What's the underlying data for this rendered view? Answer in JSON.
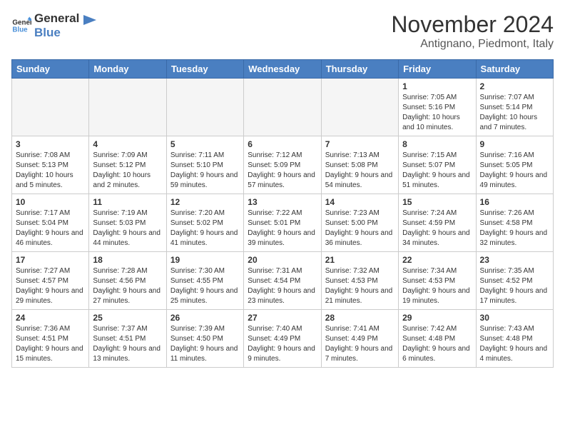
{
  "header": {
    "logo_line1": "General",
    "logo_line2": "Blue",
    "title": "November 2024",
    "subtitle": "Antignano, Piedmont, Italy"
  },
  "weekdays": [
    "Sunday",
    "Monday",
    "Tuesday",
    "Wednesday",
    "Thursday",
    "Friday",
    "Saturday"
  ],
  "weeks": [
    [
      {
        "day": "",
        "info": ""
      },
      {
        "day": "",
        "info": ""
      },
      {
        "day": "",
        "info": ""
      },
      {
        "day": "",
        "info": ""
      },
      {
        "day": "",
        "info": ""
      },
      {
        "day": "1",
        "info": "Sunrise: 7:05 AM\nSunset: 5:16 PM\nDaylight: 10 hours and 10 minutes."
      },
      {
        "day": "2",
        "info": "Sunrise: 7:07 AM\nSunset: 5:14 PM\nDaylight: 10 hours and 7 minutes."
      }
    ],
    [
      {
        "day": "3",
        "info": "Sunrise: 7:08 AM\nSunset: 5:13 PM\nDaylight: 10 hours and 5 minutes."
      },
      {
        "day": "4",
        "info": "Sunrise: 7:09 AM\nSunset: 5:12 PM\nDaylight: 10 hours and 2 minutes."
      },
      {
        "day": "5",
        "info": "Sunrise: 7:11 AM\nSunset: 5:10 PM\nDaylight: 9 hours and 59 minutes."
      },
      {
        "day": "6",
        "info": "Sunrise: 7:12 AM\nSunset: 5:09 PM\nDaylight: 9 hours and 57 minutes."
      },
      {
        "day": "7",
        "info": "Sunrise: 7:13 AM\nSunset: 5:08 PM\nDaylight: 9 hours and 54 minutes."
      },
      {
        "day": "8",
        "info": "Sunrise: 7:15 AM\nSunset: 5:07 PM\nDaylight: 9 hours and 51 minutes."
      },
      {
        "day": "9",
        "info": "Sunrise: 7:16 AM\nSunset: 5:05 PM\nDaylight: 9 hours and 49 minutes."
      }
    ],
    [
      {
        "day": "10",
        "info": "Sunrise: 7:17 AM\nSunset: 5:04 PM\nDaylight: 9 hours and 46 minutes."
      },
      {
        "day": "11",
        "info": "Sunrise: 7:19 AM\nSunset: 5:03 PM\nDaylight: 9 hours and 44 minutes."
      },
      {
        "day": "12",
        "info": "Sunrise: 7:20 AM\nSunset: 5:02 PM\nDaylight: 9 hours and 41 minutes."
      },
      {
        "day": "13",
        "info": "Sunrise: 7:22 AM\nSunset: 5:01 PM\nDaylight: 9 hours and 39 minutes."
      },
      {
        "day": "14",
        "info": "Sunrise: 7:23 AM\nSunset: 5:00 PM\nDaylight: 9 hours and 36 minutes."
      },
      {
        "day": "15",
        "info": "Sunrise: 7:24 AM\nSunset: 4:59 PM\nDaylight: 9 hours and 34 minutes."
      },
      {
        "day": "16",
        "info": "Sunrise: 7:26 AM\nSunset: 4:58 PM\nDaylight: 9 hours and 32 minutes."
      }
    ],
    [
      {
        "day": "17",
        "info": "Sunrise: 7:27 AM\nSunset: 4:57 PM\nDaylight: 9 hours and 29 minutes."
      },
      {
        "day": "18",
        "info": "Sunrise: 7:28 AM\nSunset: 4:56 PM\nDaylight: 9 hours and 27 minutes."
      },
      {
        "day": "19",
        "info": "Sunrise: 7:30 AM\nSunset: 4:55 PM\nDaylight: 9 hours and 25 minutes."
      },
      {
        "day": "20",
        "info": "Sunrise: 7:31 AM\nSunset: 4:54 PM\nDaylight: 9 hours and 23 minutes."
      },
      {
        "day": "21",
        "info": "Sunrise: 7:32 AM\nSunset: 4:53 PM\nDaylight: 9 hours and 21 minutes."
      },
      {
        "day": "22",
        "info": "Sunrise: 7:34 AM\nSunset: 4:53 PM\nDaylight: 9 hours and 19 minutes."
      },
      {
        "day": "23",
        "info": "Sunrise: 7:35 AM\nSunset: 4:52 PM\nDaylight: 9 hours and 17 minutes."
      }
    ],
    [
      {
        "day": "24",
        "info": "Sunrise: 7:36 AM\nSunset: 4:51 PM\nDaylight: 9 hours and 15 minutes."
      },
      {
        "day": "25",
        "info": "Sunrise: 7:37 AM\nSunset: 4:51 PM\nDaylight: 9 hours and 13 minutes."
      },
      {
        "day": "26",
        "info": "Sunrise: 7:39 AM\nSunset: 4:50 PM\nDaylight: 9 hours and 11 minutes."
      },
      {
        "day": "27",
        "info": "Sunrise: 7:40 AM\nSunset: 4:49 PM\nDaylight: 9 hours and 9 minutes."
      },
      {
        "day": "28",
        "info": "Sunrise: 7:41 AM\nSunset: 4:49 PM\nDaylight: 9 hours and 7 minutes."
      },
      {
        "day": "29",
        "info": "Sunrise: 7:42 AM\nSunset: 4:48 PM\nDaylight: 9 hours and 6 minutes."
      },
      {
        "day": "30",
        "info": "Sunrise: 7:43 AM\nSunset: 4:48 PM\nDaylight: 9 hours and 4 minutes."
      }
    ]
  ]
}
